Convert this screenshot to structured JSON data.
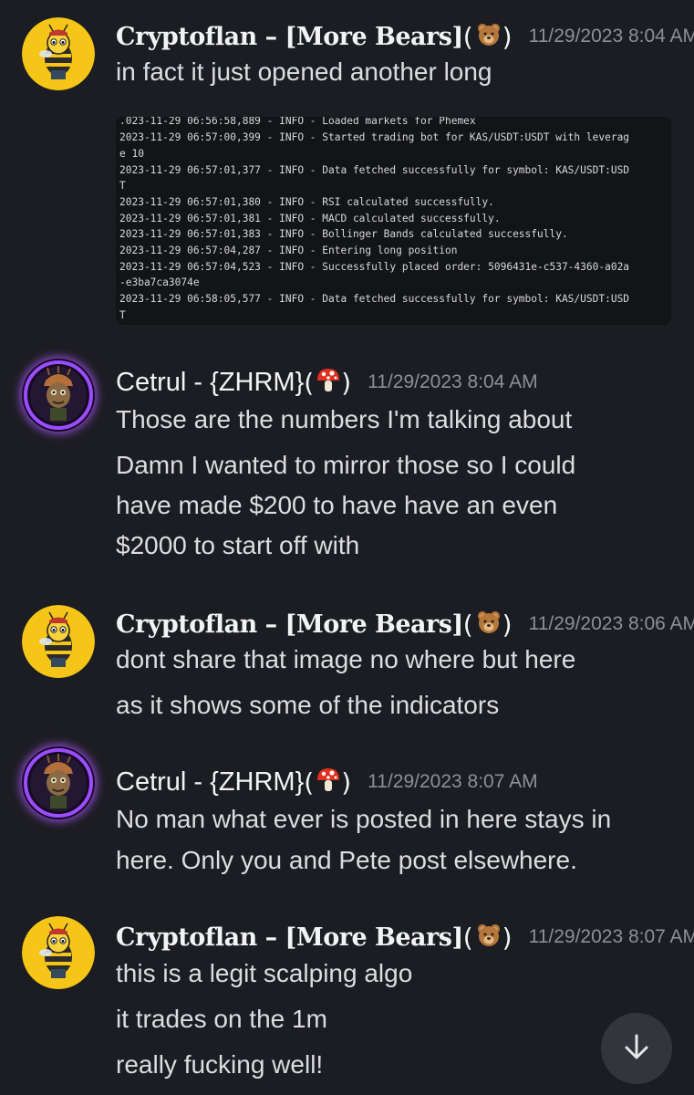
{
  "messages": [
    {
      "username": "Cryptoflan – [More Bears]",
      "timestamp": "11/29/2023 8:04 AM",
      "lines": [
        "in fact it just opened another long"
      ],
      "avatar_icon": "bee-icon",
      "badge_icon": "bear-emoji-icon"
    },
    {
      "username": "Cetrul - {ZHRM}",
      "timestamp": "11/29/2023 8:04 AM",
      "lines": [
        "Those are the numbers I'm talking about",
        "Damn I wanted to mirror those so I could",
        "have made $200 to have have an even",
        "$2000 to start off with"
      ],
      "avatar_icon": "tree-character-icon",
      "badge_icon": "mushroom-emoji-icon"
    },
    {
      "username": "Cryptoflan – [More Bears]",
      "timestamp": "11/29/2023 8:06 AM",
      "lines": [
        "dont share that image no where but here",
        "as it shows some of the indicators"
      ],
      "avatar_icon": "bee-icon",
      "badge_icon": "bear-emoji-icon"
    },
    {
      "username": "Cetrul - {ZHRM}",
      "timestamp": "11/29/2023 8:07 AM",
      "lines": [
        "No man what ever is posted in here stays in",
        "here. Only you and Pete post elsewhere."
      ],
      "avatar_icon": "tree-character-icon",
      "badge_icon": "mushroom-emoji-icon"
    },
    {
      "username": "Cryptoflan – [More Bears]",
      "timestamp": "11/29/2023 8:07 AM",
      "lines": [
        "this is a legit scalping algo",
        "it trades on the 1m",
        "really fucking well!"
      ],
      "avatar_icon": "bee-icon",
      "badge_icon": "bear-emoji-icon"
    }
  ],
  "log_image": {
    "lines": [
      ".023-11-29 06:56:58,889 - INFO - Loaded markets for Phemex",
      "2023-11-29 06:57:00,399 - INFO - Started trading bot for KAS/USDT:USDT with leverag",
      "e 10",
      "2023-11-29 06:57:01,377 - INFO - Data fetched successfully for symbol: KAS/USDT:USD",
      "T",
      "2023-11-29 06:57:01,380 - INFO - RSI calculated successfully.",
      "2023-11-29 06:57:01,381 - INFO - MACD calculated successfully.",
      "2023-11-29 06:57:01,383 - INFO - Bollinger Bands calculated successfully.",
      "2023-11-29 06:57:04,287 - INFO - Entering long position",
      "2023-11-29 06:57:04,523 - INFO - Successfully placed order: 5096431e-c537-4360-a02a",
      "-e3ba7ca3074e",
      "2023-11-29 06:58:05,577 - INFO - Data fetched successfully for symbol: KAS/USDT:USD",
      "T"
    ]
  },
  "scroll_button": {
    "icon": "arrow-down-icon"
  },
  "colors": {
    "background": "#1c1d22",
    "username": "#f2f3f5",
    "timestamp": "#8e9097",
    "message_text": "#dcdde1",
    "log_background": "#131417",
    "avatar_bee_bg": "#f5c518",
    "scroll_button_bg": "#33353b"
  }
}
